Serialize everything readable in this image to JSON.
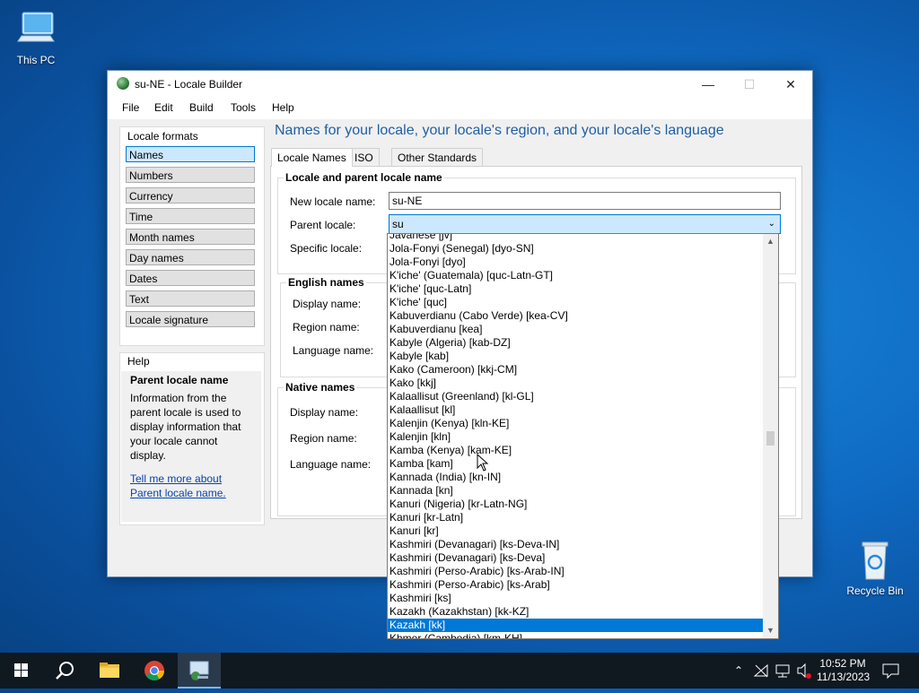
{
  "desktop": {
    "this_pc": "This PC",
    "recycle_bin": "Recycle Bin"
  },
  "window": {
    "title": "su-NE - Locale Builder",
    "controls": {
      "minimize": "—",
      "maximize": "☐",
      "close": "✕"
    },
    "menu": [
      "File",
      "Edit",
      "Build",
      "Tools",
      "Help"
    ]
  },
  "locale_formats": {
    "header": "Locale formats",
    "items": [
      "Names",
      "Numbers",
      "Currency",
      "Time",
      "Month names",
      "Day names",
      "Dates",
      "Text",
      "Locale signature"
    ],
    "selected": "Names"
  },
  "help": {
    "header": "Help",
    "title": "Parent locale name",
    "text": "Information from the parent locale is used to display information that your locale cannot display.",
    "link": "Tell me more about Parent locale name."
  },
  "main": {
    "heading": "Names for your locale, your locale's region, and your locale's language",
    "tabs": [
      "Locale Names",
      "ISO",
      "Other Standards"
    ],
    "active_tab": "Locale Names",
    "group_locale": {
      "title": "Locale and parent locale name",
      "new_locale_label": "New locale name:",
      "new_locale_value": "su-NE",
      "parent_label": "Parent locale:",
      "parent_value": "su",
      "specific_label": "Specific locale:"
    },
    "group_english": {
      "title": "English names",
      "display_label": "Display name:",
      "region_label": "Region name:",
      "language_label": "Language name:"
    },
    "group_native": {
      "title": "Native names",
      "display_label": "Display name:",
      "region_label": "Region name:",
      "language_label": "Language name:"
    }
  },
  "dropdown": {
    "items": [
      "Javanese [jv]",
      "Jola-Fonyi (Senegal) [dyo-SN]",
      "Jola-Fonyi [dyo]",
      "K'iche' (Guatemala) [quc-Latn-GT]",
      "K'iche' [quc-Latn]",
      "K'iche' [quc]",
      "Kabuverdianu (Cabo Verde) [kea-CV]",
      "Kabuverdianu [kea]",
      "Kabyle (Algeria) [kab-DZ]",
      "Kabyle [kab]",
      "Kako (Cameroon) [kkj-CM]",
      "Kako [kkj]",
      "Kalaallisut (Greenland) [kl-GL]",
      "Kalaallisut [kl]",
      "Kalenjin (Kenya) [kln-KE]",
      "Kalenjin [kln]",
      "Kamba (Kenya) [kam-KE]",
      "Kamba [kam]",
      "Kannada (India) [kn-IN]",
      "Kannada [kn]",
      "Kanuri (Nigeria) [kr-Latn-NG]",
      "Kanuri [kr-Latn]",
      "Kanuri [kr]",
      "Kashmiri (Devanagari) [ks-Deva-IN]",
      "Kashmiri (Devanagari) [ks-Deva]",
      "Kashmiri (Perso-Arabic) [ks-Arab-IN]",
      "Kashmiri (Perso-Arabic) [ks-Arab]",
      "Kashmiri [ks]",
      "Kazakh (Kazakhstan) [kk-KZ]",
      "Kazakh [kk]",
      "Khmer (Cambodia) [km-KH]"
    ],
    "selected_index": 29
  },
  "taskbar": {
    "time": "10:52 PM",
    "date": "11/13/2023"
  },
  "colors": {
    "accent": "#0078d7",
    "heading": "#1f5fa5",
    "taskbar": "#101820"
  }
}
